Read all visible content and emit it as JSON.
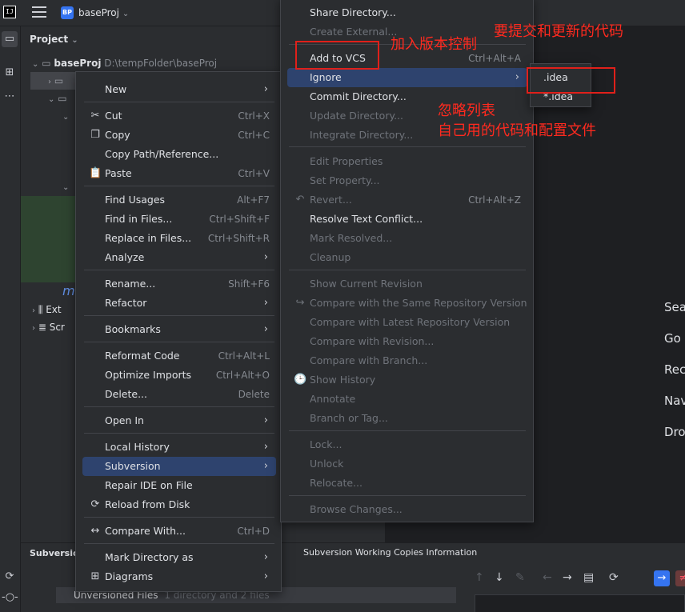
{
  "titlebar": {
    "app_icon": "IJ",
    "project_badge": "BP",
    "project_name": "baseProj",
    "project_chevron": "⌄"
  },
  "project_panel": {
    "title": "Project",
    "root_name": "baseProj",
    "root_path": "D:\\tempFolder\\baseProj",
    "partial_item": "m",
    "ext_label": "Ext",
    "scr_label": "Scr"
  },
  "context_menu": {
    "items": [
      {
        "label": "New",
        "shortcut": "",
        "submenu": true,
        "icon": ""
      },
      {
        "label": "Cut",
        "shortcut": "Ctrl+X",
        "submenu": false,
        "icon": "✂"
      },
      {
        "label": "Copy",
        "shortcut": "Ctrl+C",
        "submenu": false,
        "icon": "❐"
      },
      {
        "label": "Copy Path/Reference...",
        "shortcut": "",
        "submenu": false,
        "icon": ""
      },
      {
        "label": "Paste",
        "shortcut": "Ctrl+V",
        "submenu": false,
        "icon": "📋"
      },
      {
        "label": "Find Usages",
        "shortcut": "Alt+F7",
        "submenu": false,
        "icon": ""
      },
      {
        "label": "Find in Files...",
        "shortcut": "Ctrl+Shift+F",
        "submenu": false,
        "icon": ""
      },
      {
        "label": "Replace in Files...",
        "shortcut": "Ctrl+Shift+R",
        "submenu": false,
        "icon": ""
      },
      {
        "label": "Analyze",
        "shortcut": "",
        "submenu": true,
        "icon": ""
      },
      {
        "label": "Rename...",
        "shortcut": "Shift+F6",
        "submenu": false,
        "icon": ""
      },
      {
        "label": "Refactor",
        "shortcut": "",
        "submenu": true,
        "icon": ""
      },
      {
        "label": "Bookmarks",
        "shortcut": "",
        "submenu": true,
        "icon": ""
      },
      {
        "label": "Reformat Code",
        "shortcut": "Ctrl+Alt+L",
        "submenu": false,
        "icon": ""
      },
      {
        "label": "Optimize Imports",
        "shortcut": "Ctrl+Alt+O",
        "submenu": false,
        "icon": ""
      },
      {
        "label": "Delete...",
        "shortcut": "Delete",
        "submenu": false,
        "icon": ""
      },
      {
        "label": "Open In",
        "shortcut": "",
        "submenu": true,
        "icon": ""
      },
      {
        "label": "Local History",
        "shortcut": "",
        "submenu": true,
        "icon": ""
      },
      {
        "label": "Subversion",
        "shortcut": "",
        "submenu": true,
        "icon": ""
      },
      {
        "label": "Repair IDE on File",
        "shortcut": "",
        "submenu": false,
        "icon": ""
      },
      {
        "label": "Reload from Disk",
        "shortcut": "",
        "submenu": false,
        "icon": "⟳"
      },
      {
        "label": "Compare With...",
        "shortcut": "Ctrl+D",
        "submenu": false,
        "icon": "↔"
      },
      {
        "label": "Mark Directory as",
        "shortcut": "",
        "submenu": true,
        "icon": ""
      },
      {
        "label": "Diagrams",
        "shortcut": "",
        "submenu": true,
        "icon": "⊞"
      }
    ],
    "arrow_glyph": "›"
  },
  "svn_menu": {
    "items": [
      {
        "label": "Share Directory...",
        "shortcut": "",
        "disabled": false
      },
      {
        "label": "Create External...",
        "shortcut": "",
        "disabled": true
      },
      {
        "label": "Add to VCS",
        "shortcut": "Ctrl+Alt+A",
        "disabled": false
      },
      {
        "label": "Ignore",
        "shortcut": "",
        "disabled": false
      },
      {
        "label": "Commit Directory...",
        "shortcut": "",
        "disabled": false
      },
      {
        "label": "Update Directory...",
        "shortcut": "",
        "disabled": true
      },
      {
        "label": "Integrate Directory...",
        "shortcut": "",
        "disabled": true
      },
      {
        "label": "Edit Properties",
        "shortcut": "",
        "disabled": true
      },
      {
        "label": "Set Property...",
        "shortcut": "",
        "disabled": true
      },
      {
        "label": "Revert...",
        "shortcut": "Ctrl+Alt+Z",
        "disabled": true
      },
      {
        "label": "Resolve Text Conflict...",
        "shortcut": "",
        "disabled": false
      },
      {
        "label": "Mark Resolved...",
        "shortcut": "",
        "disabled": true
      },
      {
        "label": "Cleanup",
        "shortcut": "",
        "disabled": true
      },
      {
        "label": "Show Current Revision",
        "shortcut": "",
        "disabled": true
      },
      {
        "label": "Compare with the Same Repository Version",
        "shortcut": "",
        "disabled": true
      },
      {
        "label": "Compare with Latest Repository Version",
        "shortcut": "",
        "disabled": true
      },
      {
        "label": "Compare with Revision...",
        "shortcut": "",
        "disabled": true
      },
      {
        "label": "Compare with Branch...",
        "shortcut": "",
        "disabled": true
      },
      {
        "label": "Show History",
        "shortcut": "",
        "disabled": true
      },
      {
        "label": "Annotate",
        "shortcut": "",
        "disabled": true
      },
      {
        "label": "Branch or Tag...",
        "shortcut": "",
        "disabled": true
      },
      {
        "label": "Lock...",
        "shortcut": "",
        "disabled": true
      },
      {
        "label": "Unlock",
        "shortcut": "",
        "disabled": true
      },
      {
        "label": "Relocate...",
        "shortcut": "",
        "disabled": true
      },
      {
        "label": "Browse Changes...",
        "shortcut": "",
        "disabled": true
      }
    ]
  },
  "ignore_menu": {
    "items": [
      ".idea",
      "*.idea"
    ]
  },
  "annotations": {
    "add_to_vcs_note": "加入版本控制",
    "commit_note": "要提交和更新的代码",
    "ignore_note_1": "忽略列表",
    "ignore_note_2": "自己用的代码和配置文件"
  },
  "welcome_hints": [
    "Sea",
    "Go",
    "Rec",
    "Nav",
    "Dro"
  ],
  "bottom_panel": {
    "tab_label": "Subversion",
    "info_title": "Subversion Working Copies Information",
    "unversioned_label": "Unversioned Files",
    "unversioned_detail": "1 directory and 2 files"
  },
  "colors": {
    "accent": "#3574f0",
    "selection": "#2e436e",
    "annotation": "#e0201a"
  }
}
